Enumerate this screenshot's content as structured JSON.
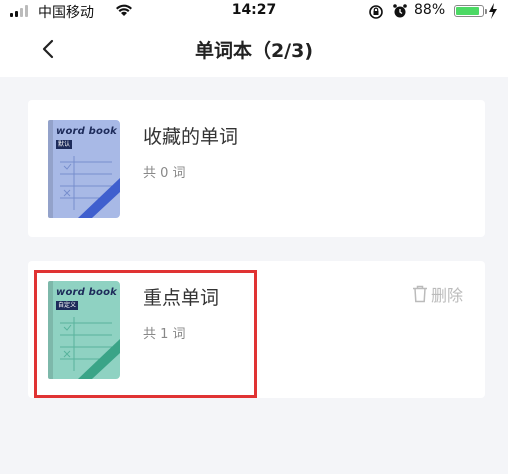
{
  "status_bar": {
    "carrier": "中国移动",
    "time": "14:27",
    "battery_percent": "88%",
    "battery_level": 0.88,
    "icons": [
      "signal-icon",
      "wifi-icon",
      "rotation-lock-icon",
      "alarm-icon",
      "battery-icon",
      "charging-icon"
    ]
  },
  "nav": {
    "title": "单词本（2/3)",
    "back_icon": "chevron-left-icon"
  },
  "books": [
    {
      "name": "收藏的单词",
      "count": "共 0 词",
      "cover_title": "word book",
      "cover_tag": "默认",
      "cover_color": "#a8b9e6",
      "stripe_color": "#3f5fce"
    },
    {
      "name": "重点单词",
      "count": "共 1 词",
      "cover_title": "word book",
      "cover_tag": "自定义",
      "cover_color": "#8fd2c2",
      "stripe_color": "#3aa487",
      "delete_label": "删除",
      "delete_icon": "trash-icon"
    }
  ],
  "highlight_color": "#e03333"
}
